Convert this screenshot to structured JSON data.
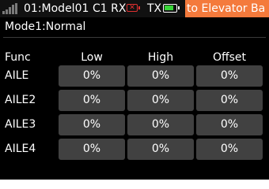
{
  "status_bar": {
    "model": "01:Model01",
    "rx_label": "C1 RX",
    "rx_status_icon": "rx-disconnected-icon",
    "tx_label": "TX",
    "tx_battery_icon": "battery-icon",
    "banner": "to Elevator  Ba",
    "banner_color": "#f47a3c"
  },
  "mode": "Mode1:Normal",
  "table": {
    "headers": {
      "func": "Func",
      "low": "Low",
      "high": "High",
      "offset": "Offset"
    },
    "rows": [
      {
        "func": "AILE",
        "low": "0%",
        "high": "0%",
        "offset": "0%"
      },
      {
        "func": "AILE2",
        "low": "0%",
        "high": "0%",
        "offset": "0%"
      },
      {
        "func": "AILE3",
        "low": "0%",
        "high": "0%",
        "offset": "0%"
      },
      {
        "func": "AILE4",
        "low": "0%",
        "high": "0%",
        "offset": "0%"
      }
    ]
  },
  "colors": {
    "background": "#000000",
    "cell": "#414141",
    "rx_alert": "#e03030",
    "battery_fill": "#39d639"
  }
}
